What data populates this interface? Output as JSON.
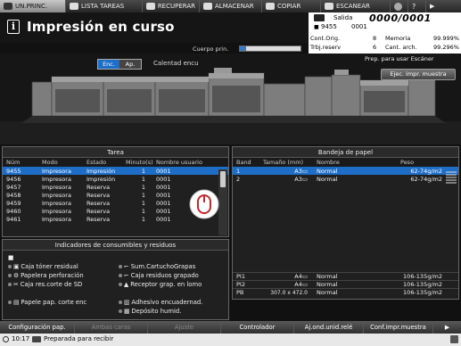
{
  "tabs": [
    {
      "label": "UN.PRINC."
    },
    {
      "label": "LISTA TAREAS"
    },
    {
      "label": "RECUPERAR"
    },
    {
      "label": "ALMACENAR"
    },
    {
      "label": "COPIAR"
    },
    {
      "label": "ESCANEAR"
    }
  ],
  "header": {
    "title": "Impresión en curso",
    "info_icon": "i"
  },
  "counter": {
    "label": "Salida",
    "value": "0000/0001",
    "user_id": "9455",
    "job_num": "0001"
  },
  "stats": {
    "cont_orig_label": "Cont.Orig.",
    "cont_orig_value": "8",
    "memoria_label": "Memoria",
    "memoria_value": "99.999%",
    "trbj_label": "Trbj.reserv",
    "trbj_value": "6",
    "cant_label": "Cant. arch.",
    "cant_value": "99.296%"
  },
  "memory": {
    "label": "Cuerpo prin.",
    "level": 0.1
  },
  "enc": {
    "enc_label": "Enc.",
    "ap_label": "Ap.",
    "desc": "Calentad encu"
  },
  "scanner": {
    "prep": "Prep. para usar Escáner",
    "button": "Ejec. impr. muestra"
  },
  "tasks": {
    "title": "Tarea",
    "headers": [
      "Núm",
      "Modo",
      "Estado",
      "Minuto(s)",
      "Nombre usuario"
    ],
    "rows": [
      [
        "9455",
        "Impresora",
        "Impresión",
        "1",
        "0001"
      ],
      [
        "9456",
        "Impresora",
        "Impresión",
        "1",
        "0001"
      ],
      [
        "9457",
        "Impresora",
        "Reserva",
        "1",
        "0001"
      ],
      [
        "9458",
        "Impresora",
        "Reserva",
        "1",
        "0001"
      ],
      [
        "9459",
        "Impresora",
        "Reserva",
        "1",
        "0001"
      ],
      [
        "9460",
        "Impresora",
        "Reserva",
        "1",
        "0001"
      ],
      [
        "9461",
        "Impresora",
        "Reserva",
        "1",
        "0001"
      ]
    ]
  },
  "tray": {
    "title": "Bandeja de papel",
    "headers": [
      "Band",
      "Tamaño (mm)",
      "Nombre",
      "Peso"
    ],
    "rows": [
      [
        "1",
        "A3▭",
        "Normal",
        "62-74g/m2"
      ],
      [
        "2",
        "A3▭",
        "Normal",
        "62-74g/m2"
      ]
    ],
    "rows_bottom": [
      [
        "PI1",
        "A4▭",
        "Normal",
        "106-135g/m2"
      ],
      [
        "PI2",
        "A4▭",
        "Normal",
        "106-135g/m2"
      ],
      [
        "PB",
        "307.0 x 472.0",
        "Normal",
        "106-135g/m2"
      ]
    ]
  },
  "consum": {
    "title": "Indicadores de consumibles y residuos",
    "items": [
      "Caja tóner residual",
      "Papelera perforación",
      "Caja res.corte de SD",
      "Sum.CartuchoGrapas",
      "Caja residuos grapado",
      "Receptor grap. en lomo",
      "Papele pap. corte enc",
      "Adhesivo encuadernad.",
      "Depósito humid."
    ]
  },
  "bottom": [
    "Configuración pap.",
    "Ambas caras",
    "Ajuste",
    "Controlador",
    "Aj.ond.unid.relé",
    "Conf.impr.muestra"
  ],
  "status": {
    "time": "10:17",
    "text": "Preparada para recibir"
  }
}
